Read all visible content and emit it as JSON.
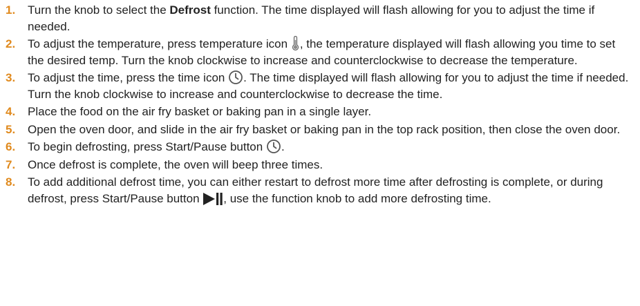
{
  "steps": [
    {
      "number": "1.",
      "text_before": "Turn the knob to select the ",
      "bold": "Defrost",
      "text_after": " function. The time displayed will flash allowing for you to adjust the time if needed."
    },
    {
      "number": "2.",
      "text_before": "To adjust the temperature, press temperature icon ",
      "icon": "thermometer-icon",
      "text_after": ", the temperature displayed will flash allowing you time to set the desired temp. Turn the knob clockwise to increase and counterclockwise to decrease the temperature."
    },
    {
      "number": "3.",
      "text_before": "To adjust the time, press the time icon ",
      "icon": "clock-icon",
      "text_after": ". The time displayed will flash allowing for you to adjust the time if needed. Turn the knob clockwise to increase and counterclockwise to decrease the time."
    },
    {
      "number": "4.",
      "text": "Place the food on the air fry basket or baking pan in a single layer."
    },
    {
      "number": "5.",
      "text": "Open the oven door, and slide in the air fry basket or baking pan in the top rack position, then close the oven door."
    },
    {
      "number": "6.",
      "text_before": "To begin defrosting, press Start/Pause button ",
      "icon": "clock-icon",
      "text_after": "."
    },
    {
      "number": "7.",
      "text": "Once defrost is complete, the oven will beep three times."
    },
    {
      "number": "8.",
      "text_before": "To add additional defrost time, you can either restart to defrost more time after defrosting is complete, or during defrost, press Start/Pause button ",
      "icon": "play-pause-icon",
      "text_after": ", use the function knob to add more defrosting time."
    }
  ],
  "colors": {
    "number": "#e08a1e",
    "text": "#222222",
    "icon": "#555555"
  }
}
